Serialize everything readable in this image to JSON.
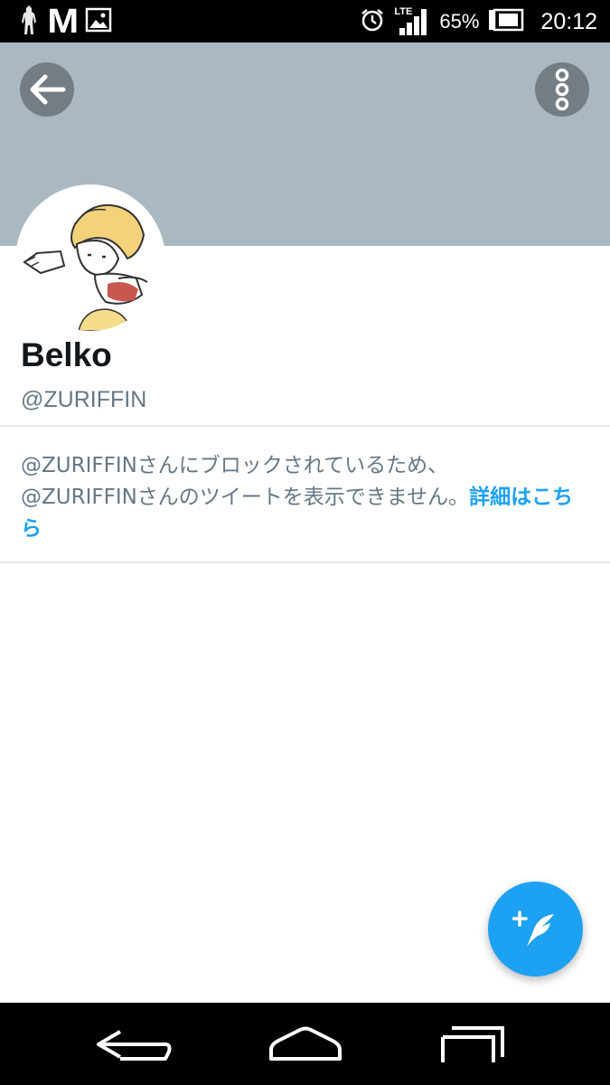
{
  "status_bar": {
    "battery_percent": "65%",
    "network": "LTE",
    "time": "20:12",
    "app_logo": "M",
    "icons": [
      "character-icon",
      "mcdonalds-icon",
      "image-icon",
      "alarm-icon",
      "lte-signal-icon",
      "battery-icon"
    ]
  },
  "header": {
    "back_icon": "arrow-left-icon",
    "more_icon": "vertical-dots-icon",
    "banner_color": "#aab8c2"
  },
  "profile": {
    "display_name": "Belko",
    "handle": "@ZURIFFIN"
  },
  "blocked_notice": {
    "line1": "@ZURIFFINさんにブロックされているため、",
    "line2": "@ZURIFFINさんのツイートを表示できません。",
    "link_text": "詳細はこちら"
  },
  "fab": {
    "icon": "compose-tweet-icon",
    "color": "#1da1f2"
  },
  "nav_bar": {
    "icons": [
      "nav-back-icon",
      "nav-home-icon",
      "nav-recent-apps-icon"
    ]
  }
}
